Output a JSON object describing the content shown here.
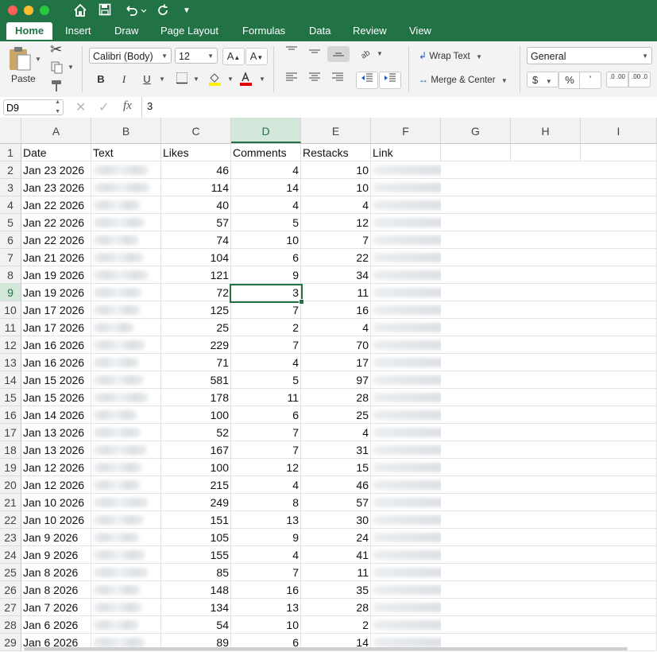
{
  "app": {
    "tabs": [
      "Home",
      "Insert",
      "Draw",
      "Page Layout",
      "Formulas",
      "Data",
      "Review",
      "View"
    ],
    "active_tab": "Home",
    "accent_color": "#217346"
  },
  "ribbon": {
    "paste_label": "Paste",
    "font_name": "Calibri (Body)",
    "font_size": "12",
    "grow_font": "A",
    "shrink_font": "A",
    "bold": "B",
    "italic": "I",
    "underline": "U",
    "wrap_text": "Wrap Text",
    "merge_center": "Merge & Center",
    "number_format": "General",
    "currency": "$",
    "percent": "%",
    "comma": "ʾ",
    "inc_decimal": ".0 .00",
    "dec_decimal": ".00 .0"
  },
  "formula_bar": {
    "name_box": "D9",
    "fx": "fx",
    "value": "3"
  },
  "columns": [
    "A",
    "B",
    "C",
    "D",
    "E",
    "F",
    "G",
    "H",
    "I"
  ],
  "header_row": {
    "A": "Date",
    "B": "Text",
    "C": "Likes",
    "D": "Comments",
    "E": "Restacks",
    "F": "Link"
  },
  "rows": [
    {
      "n": "2",
      "date": "Jan 23 2026",
      "likes": "46",
      "comments": "4",
      "restacks": "10"
    },
    {
      "n": "3",
      "date": "Jan 23 2026",
      "likes": "114",
      "comments": "14",
      "restacks": "10"
    },
    {
      "n": "4",
      "date": "Jan 22 2026",
      "likes": "40",
      "comments": "4",
      "restacks": "4"
    },
    {
      "n": "5",
      "date": "Jan 22 2026",
      "likes": "57",
      "comments": "5",
      "restacks": "12"
    },
    {
      "n": "6",
      "date": "Jan 22 2026",
      "likes": "74",
      "comments": "10",
      "restacks": "7"
    },
    {
      "n": "7",
      "date": "Jan 21 2026",
      "likes": "104",
      "comments": "6",
      "restacks": "22"
    },
    {
      "n": "8",
      "date": "Jan 19 2026",
      "likes": "121",
      "comments": "9",
      "restacks": "34"
    },
    {
      "n": "9",
      "date": "Jan 19 2026",
      "likes": "72",
      "comments": "3",
      "restacks": "11"
    },
    {
      "n": "10",
      "date": "Jan 17 2026",
      "likes": "125",
      "comments": "7",
      "restacks": "16"
    },
    {
      "n": "11",
      "date": "Jan 17 2026",
      "likes": "25",
      "comments": "2",
      "restacks": "4"
    },
    {
      "n": "12",
      "date": "Jan 16 2026",
      "likes": "229",
      "comments": "7",
      "restacks": "70"
    },
    {
      "n": "13",
      "date": "Jan 16 2026",
      "likes": "71",
      "comments": "4",
      "restacks": "17"
    },
    {
      "n": "14",
      "date": "Jan 15 2026",
      "likes": "581",
      "comments": "5",
      "restacks": "97"
    },
    {
      "n": "15",
      "date": "Jan 15 2026",
      "likes": "178",
      "comments": "11",
      "restacks": "28"
    },
    {
      "n": "16",
      "date": "Jan 14 2026",
      "likes": "100",
      "comments": "6",
      "restacks": "25"
    },
    {
      "n": "17",
      "date": "Jan 13 2026",
      "likes": "52",
      "comments": "7",
      "restacks": "4"
    },
    {
      "n": "18",
      "date": "Jan 13 2026",
      "likes": "167",
      "comments": "7",
      "restacks": "31"
    },
    {
      "n": "19",
      "date": "Jan 12 2026",
      "likes": "100",
      "comments": "12",
      "restacks": "15"
    },
    {
      "n": "20",
      "date": "Jan 12 2026",
      "likes": "215",
      "comments": "4",
      "restacks": "46"
    },
    {
      "n": "21",
      "date": "Jan 10 2026",
      "likes": "249",
      "comments": "8",
      "restacks": "57"
    },
    {
      "n": "22",
      "date": "Jan 10 2026",
      "likes": "151",
      "comments": "13",
      "restacks": "30"
    },
    {
      "n": "23",
      "date": "Jan 9 2026",
      "likes": "105",
      "comments": "9",
      "restacks": "24"
    },
    {
      "n": "24",
      "date": "Jan 9 2026",
      "likes": "155",
      "comments": "4",
      "restacks": "41"
    },
    {
      "n": "25",
      "date": "Jan 8 2026",
      "likes": "85",
      "comments": "7",
      "restacks": "11"
    },
    {
      "n": "26",
      "date": "Jan 8 2026",
      "likes": "148",
      "comments": "16",
      "restacks": "35"
    },
    {
      "n": "27",
      "date": "Jan 7 2026",
      "likes": "134",
      "comments": "13",
      "restacks": "28"
    },
    {
      "n": "28",
      "date": "Jan 6 2026",
      "likes": "54",
      "comments": "10",
      "restacks": "2"
    },
    {
      "n": "29",
      "date": "Jan 6 2026",
      "likes": "89",
      "comments": "6",
      "restacks": "14"
    }
  ],
  "selection": {
    "row": "9",
    "column": "D"
  }
}
